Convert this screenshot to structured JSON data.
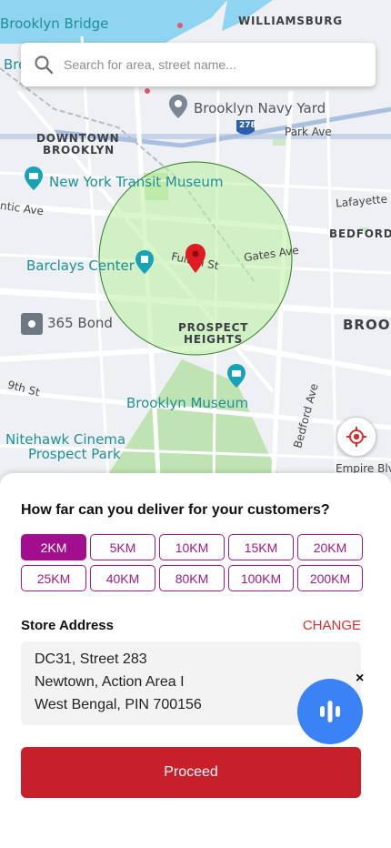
{
  "map": {
    "labels": {
      "brooklyn_bridge": "Brooklyn Bridge",
      "williamsburg": "WILLIAMSBURG",
      "bro_partial": "Bro",
      "navy_yard": "Brooklyn Navy Yard",
      "downtown_1": "DOWNTOWN",
      "downtown_2": "BROOKLYN",
      "shield": "278",
      "park_ave": "Park Ave",
      "transit_museum": "New York Transit Museum",
      "lafayette": "Lafayette Ave",
      "atlantic": "ntic Ave",
      "bedford_upper": "BEDFORD-",
      "barclays": "Barclays Center",
      "fulton": "Fulton St",
      "gates": "Gates Ave",
      "brook_partial": "BROOK",
      "bond": "365 Bond",
      "prospect_1": "PROSPECT",
      "prospect_2": "HEIGHTS",
      "ninth": "9th St",
      "museum": "Brooklyn Museum",
      "bedford_ave": "Bedford Ave",
      "nitehawk_1": "Nitehawk Cinema",
      "nitehawk_2": "Prospect Park",
      "empire": "Empire Blv"
    }
  },
  "search": {
    "placeholder": "Search for area, street name..."
  },
  "sheet": {
    "question": "How far can you deliver for your customers?",
    "distances": [
      {
        "label": "2KM",
        "selected": true
      },
      {
        "label": "5KM",
        "selected": false
      },
      {
        "label": "10KM",
        "selected": false
      },
      {
        "label": "15KM",
        "selected": false
      },
      {
        "label": "20KM",
        "selected": false
      },
      {
        "label": "25KM",
        "selected": false
      },
      {
        "label": "40KM",
        "selected": false
      },
      {
        "label": "80KM",
        "selected": false
      },
      {
        "label": "100KM",
        "selected": false
      },
      {
        "label": "200KM",
        "selected": false
      }
    ],
    "store_label": "Store Address",
    "change_label": "CHANGE",
    "address_lines": [
      "DC31, Street 283",
      "Newtown, Action Area I",
      "West Bengal, PIN 700156"
    ],
    "proceed_label": "Proceed",
    "mic_close": "×"
  },
  "colors": {
    "accent": "#a30e8e",
    "primary_button": "#c8202b",
    "change_link": "#d32f2f",
    "radius_fill": "#b9f0a0",
    "radius_stroke": "#2e7d22",
    "pin": "#e11b22",
    "mic": "#3b82f6"
  },
  "icons": {
    "search": "search-icon",
    "locate": "target-icon",
    "pin": "map-pin-icon",
    "mic": "voice-wave-icon",
    "close": "close-icon"
  }
}
